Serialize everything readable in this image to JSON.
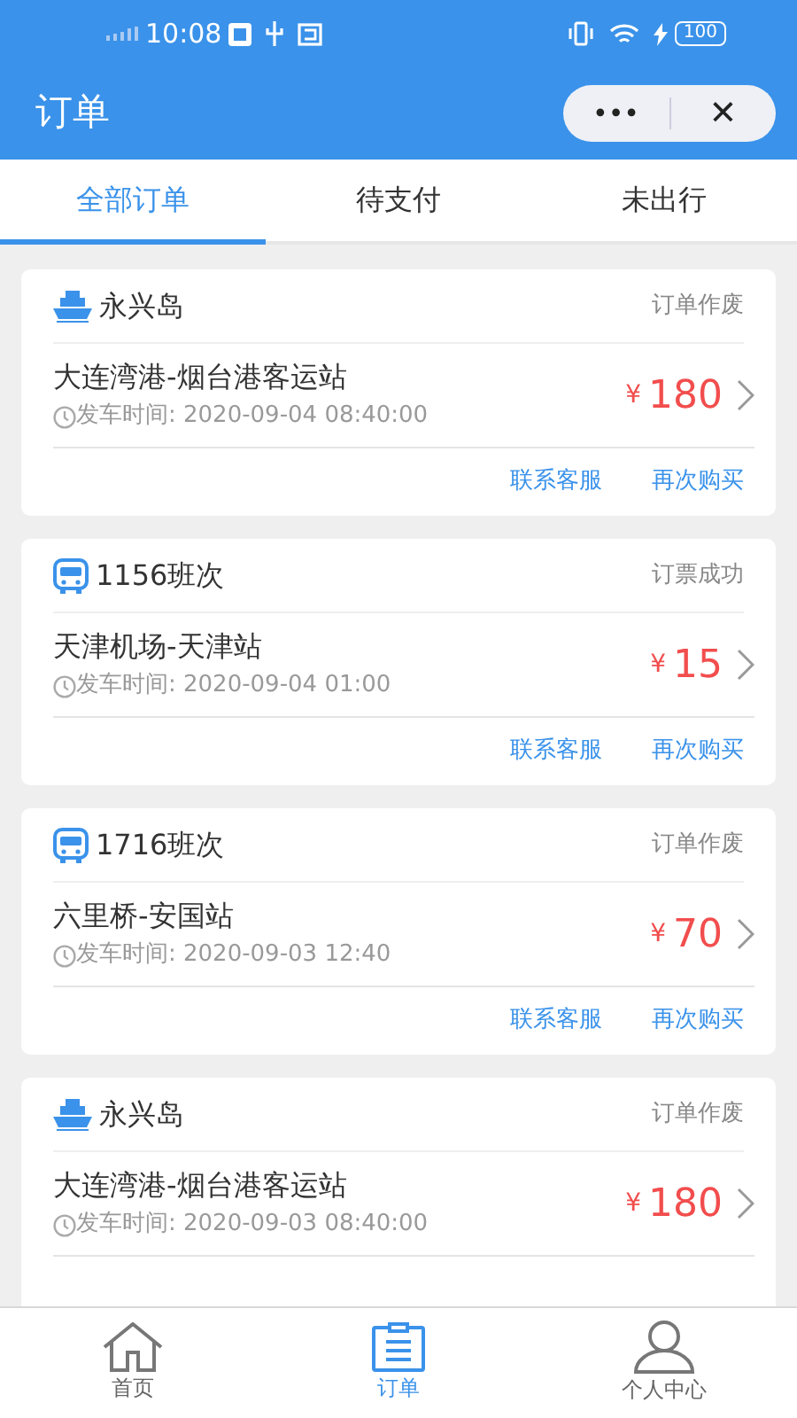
{
  "status_bar": {
    "time": "10:08",
    "battery": "100"
  },
  "header": {
    "title": "订单",
    "menu_button": "•••",
    "close_button": "✕"
  },
  "tabs": [
    {
      "label": "全部订单",
      "selected": true
    },
    {
      "label": "待支付",
      "selected": false
    },
    {
      "label": "未出行",
      "selected": false
    }
  ],
  "orders": [
    {
      "kind": "ship",
      "name": "永兴岛",
      "status": "订单作废",
      "route": "大连湾港-烟台港客运站",
      "departure": "发车时间: 2020-09-04 08:40:00",
      "currency": "¥",
      "price": "180",
      "actions": [
        "联系客服",
        "再次购买"
      ]
    },
    {
      "kind": "bus",
      "name": "1156班次",
      "status": "订票成功",
      "route": "天津机场-天津站",
      "departure": "发车时间: 2020-09-04 01:00",
      "currency": "¥",
      "price": "15",
      "actions": [
        "联系客服",
        "再次购买"
      ]
    },
    {
      "kind": "bus",
      "name": "1716班次",
      "status": "订单作废",
      "route": "六里桥-安国站",
      "departure": "发车时间: 2020-09-03 12:40",
      "currency": "¥",
      "price": "70",
      "actions": [
        "联系客服",
        "再次购买"
      ]
    },
    {
      "kind": "ship",
      "name": "永兴岛",
      "status": "订单作废",
      "route": "大连湾港-烟台港客运站",
      "departure": "发车时间: 2020-09-03 08:40:00",
      "currency": "¥",
      "price": "180"
    }
  ],
  "bottom_nav": [
    {
      "kind": "home",
      "label": "首页",
      "selected": false
    },
    {
      "kind": "orders",
      "label": "订单",
      "selected": true
    },
    {
      "kind": "profile",
      "label": "个人中心",
      "selected": false
    }
  ]
}
